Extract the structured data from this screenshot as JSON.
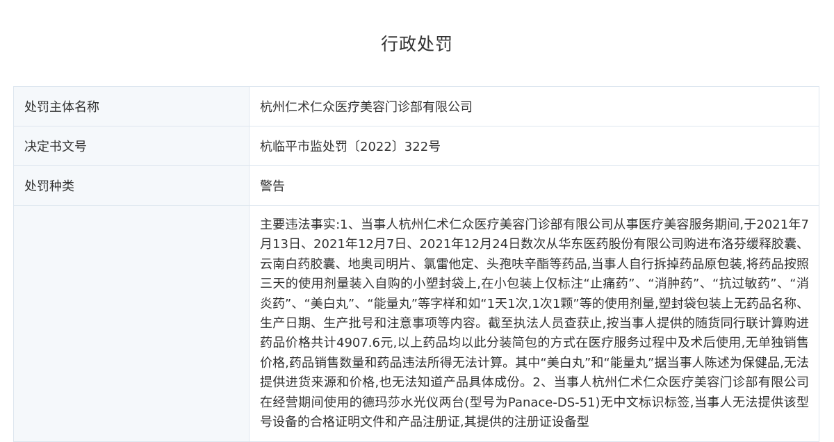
{
  "page": {
    "title": "行政处罚"
  },
  "table": {
    "rows": [
      {
        "label": "处罚主体名称",
        "value": "杭州仁术仁众医疗美容门诊部有限公司"
      },
      {
        "label": "决定书文号",
        "value": "杭临平市监处罚〔2022〕322号"
      },
      {
        "label": "处罚种类",
        "value": "警告"
      },
      {
        "label": "",
        "value": "主要违法事实:1、当事人杭州仁术仁众医疗美容门诊部有限公司从事医疗美容服务期间,于2021年7月13日、2021年12月7日、2021年12月24日数次从华东医药股份有限公司购进布洛芬缓释胶囊、云南白药胶囊、地奥司明片、氯雷他定、头孢呋辛酯等药品,当事人自行拆掉药品原包装,将药品按照三天的使用剂量装入自购的小塑封袋上,在小包装上仅标注“止痛药”、“消肿药”、“抗过敏药”、“消炎药”、“美白丸”、“能量丸”等字样和如“1天1次,1次1颗”等的使用剂量,塑封袋包装上无药品名称、生产日期、生产批号和注意事项等内容。截至执法人员查获止,按当事人提供的随货同行联计算购进药品价格共计4907.6元,以上药品均以此分装简包的方式在医疗服务过程中及术后使用,无单独销售价格,药品销售数量和药品违法所得无法计算。其中“美白丸”和“能量丸”据当事人陈述为保健品,无法提供进货来源和价格,也无法知道产品具体成份。2、当事人杭州仁术仁众医疗美容门诊部有限公司在经营期间使用的德玛莎水光仪两台(型号为Panace-DS-51)无中文标识标签,当事人无法提供该型号设备的合格证明文件和产品注册证,其提供的注册证设备型"
      }
    ]
  }
}
